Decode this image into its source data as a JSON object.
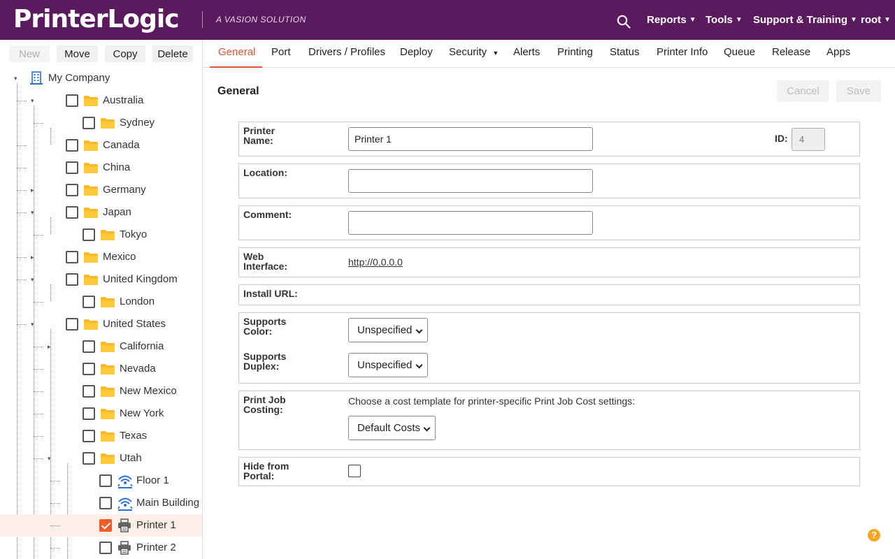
{
  "app": {
    "logo": "PrinterLogic",
    "tagline": "A VASION SOLUTION"
  },
  "topnav": [
    {
      "label": "Reports"
    },
    {
      "label": "Tools"
    },
    {
      "label": "Support & Training"
    },
    {
      "label": "root"
    }
  ],
  "tree_toolbar": {
    "new": "New",
    "move": "Move",
    "copy": "Copy",
    "delete": "Delete"
  },
  "tree": [
    {
      "label": "My Company",
      "icon": "building-icon",
      "checked": false
    },
    {
      "label": "Australia",
      "icon": "folder-icon",
      "checked": false
    },
    {
      "label": "Sydney",
      "icon": "folder-icon",
      "checked": false
    },
    {
      "label": "Canada",
      "icon": "folder-icon",
      "checked": false
    },
    {
      "label": "China",
      "icon": "folder-icon",
      "checked": false
    },
    {
      "label": "Germany",
      "icon": "folder-icon",
      "checked": false
    },
    {
      "label": "Japan",
      "icon": "folder-icon",
      "checked": false
    },
    {
      "label": "Tokyo",
      "icon": "folder-icon",
      "checked": false
    },
    {
      "label": "Mexico",
      "icon": "folder-icon",
      "checked": false
    },
    {
      "label": "United Kingdom",
      "icon": "folder-icon",
      "checked": false
    },
    {
      "label": "London",
      "icon": "folder-icon",
      "checked": false
    },
    {
      "label": "United States",
      "icon": "folder-icon",
      "checked": false
    },
    {
      "label": "California",
      "icon": "folder-icon",
      "checked": false
    },
    {
      "label": "Nevada",
      "icon": "folder-icon",
      "checked": false
    },
    {
      "label": "New Mexico",
      "icon": "folder-icon",
      "checked": false
    },
    {
      "label": "New York",
      "icon": "folder-icon",
      "checked": false
    },
    {
      "label": "Texas",
      "icon": "folder-icon",
      "checked": false
    },
    {
      "label": "Utah",
      "icon": "folder-icon",
      "checked": false
    },
    {
      "label": "Floor 1",
      "icon": "wifi-icon",
      "checked": false
    },
    {
      "label": "Main Building",
      "icon": "wifi-icon",
      "checked": false
    },
    {
      "label": "Printer 1",
      "icon": "printer-icon",
      "checked": true
    },
    {
      "label": "Printer 2",
      "icon": "printer-icon",
      "checked": false
    }
  ],
  "tabs": [
    {
      "label": "General"
    },
    {
      "label": "Port"
    },
    {
      "label": "Drivers / Profiles"
    },
    {
      "label": "Deploy"
    },
    {
      "label": "Security"
    },
    {
      "label": "Alerts"
    },
    {
      "label": "Printing"
    },
    {
      "label": "Status"
    },
    {
      "label": "Printer Info"
    },
    {
      "label": "Queue"
    },
    {
      "label": "Release"
    },
    {
      "label": "Apps"
    }
  ],
  "form": {
    "title": "General",
    "cancel": "Cancel",
    "save": "Save",
    "printer_name_label": "Printer Name:",
    "printer_name_value": "Printer 1",
    "id_label": "ID:",
    "id_value": "4",
    "location_label": "Location:",
    "location_value": "",
    "comment_label": "Comment:",
    "comment_value": "",
    "web_interface_label": "Web Interface:",
    "web_interface_value": "http://0.0.0.0",
    "install_url_label": "Install URL:",
    "supports_color_label": "Supports Color:",
    "supports_color_value": "Unspecified",
    "supports_duplex_label": "Supports Duplex:",
    "supports_duplex_value": "Unspecified",
    "costing_label": "Print Job Costing:",
    "costing_text": "Choose a cost template for printer-specific Print Job Cost settings:",
    "costing_value": "Default Costs",
    "hide_portal_label": "Hide from Portal:"
  },
  "colors": {
    "topbar": "#5b1a5e",
    "accent": "#e4572e",
    "folder": "#f9b928",
    "selected_row": "#fdefe7"
  }
}
